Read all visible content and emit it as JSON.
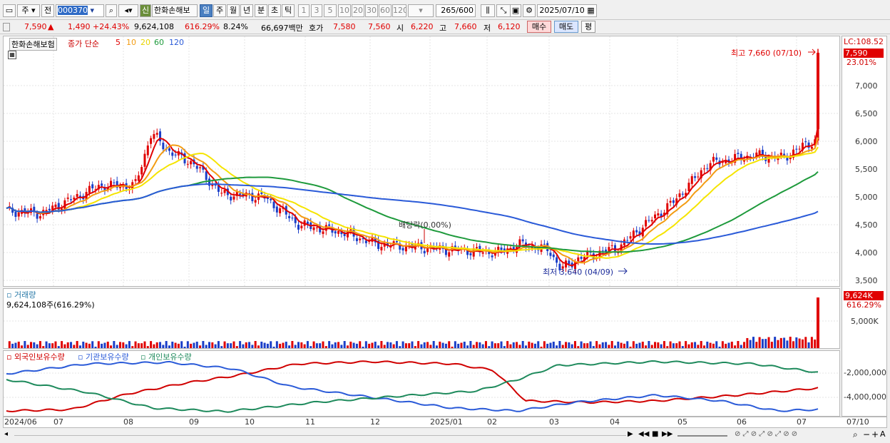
{
  "toolbar": {
    "market_left": "주",
    "prev_label": "전",
    "stock_code": "000370",
    "new_label": "신",
    "stock_name": "한화손해보",
    "periods": [
      "일",
      "주",
      "월",
      "년",
      "분",
      "초",
      "틱"
    ],
    "selected_period": "일",
    "minute_options": [
      "1",
      "3",
      "5",
      "10",
      "20",
      "30",
      "60",
      "120"
    ],
    "count": "265",
    "count_max": "/600",
    "date": "2025/07/10"
  },
  "info": {
    "price": "7,590",
    "change": "1,490",
    "change_pct": "+24.43%",
    "volume": "9,624,108",
    "volume_pct": "616.29%",
    "turnover": "8.24%",
    "amount": "66,697백만",
    "ask_label": "호가",
    "ask": "7,580",
    "bid": "7,560",
    "open_label": "시",
    "open": "6,220",
    "high_label": "고",
    "high": "7,660",
    "low_label": "저",
    "low": "6,120",
    "buy_label": "매수",
    "sell_label": "매도",
    "eval_label": "평"
  },
  "legend": {
    "name": "한화손해보험",
    "ma_title": "종가 단순",
    "ma": [
      "5",
      "10",
      "20",
      "60",
      "120"
    ]
  },
  "annotations": {
    "high": "최고 7,660 (07/10)",
    "low": "최저 3,640 (04/09)",
    "dividend": "배당락(0.00%)"
  },
  "right_axis": {
    "lc": "LC:108.52",
    "price_tag": "7,590",
    "pct_tag": "23.01%",
    "price_ticks": [
      "7,000",
      "6,500",
      "6,000",
      "5,500",
      "5,000",
      "4,500",
      "4,000",
      "3,500"
    ],
    "vol_tag": "9,624K",
    "vol_pct": "616.29%",
    "vol_tick": "5,000K",
    "holding_ticks": [
      "-2,000,000",
      "-4,000,000"
    ]
  },
  "volume_panel": {
    "title": "거래량",
    "value": "9,624,108주(616.29%)"
  },
  "holding_panel": {
    "series": [
      "외국인보유수량",
      "기관보유수량",
      "개인보유수량"
    ]
  },
  "x_axis": [
    "2024/06",
    "07",
    "08",
    "09",
    "10",
    "11",
    "12",
    "2025/01",
    "02",
    "03",
    "04",
    "05",
    "06",
    "07"
  ],
  "x_right": "07/10",
  "colors": {
    "up": "#e00000",
    "down": "#1a3ec8",
    "ma5": "#e00000",
    "ma10": "#f39c12",
    "ma20": "#f5e400",
    "ma60": "#1e9a3c",
    "ma120": "#2a5ad8"
  },
  "chart_data": {
    "type": "candlestick",
    "title": "한화손해보험",
    "ylim": [
      3500,
      7700
    ],
    "x_ticks": [
      "2024/06",
      "07",
      "08",
      "09",
      "10",
      "11",
      "12",
      "2025/01",
      "02",
      "03",
      "04",
      "05",
      "06",
      "07"
    ],
    "key_points": [
      {
        "date": "2024/06",
        "close": 4750
      },
      {
        "date": "2024/08",
        "close": 6100
      },
      {
        "date": "2024/09",
        "close": 5600
      },
      {
        "date": "2024/10",
        "close": 5000
      },
      {
        "date": "2024/11",
        "close": 4700
      },
      {
        "date": "2024/12",
        "close": 4300
      },
      {
        "date": "2025/01",
        "close": 4100
      },
      {
        "date": "2025/02",
        "close": 4000
      },
      {
        "date": "2025/03",
        "close": 4050
      },
      {
        "date": "2025/04/09",
        "close": 3640
      },
      {
        "date": "2025/05",
        "close": 4000
      },
      {
        "date": "2025/06",
        "close": 5700
      },
      {
        "date": "2025/07/10",
        "close": 7590
      }
    ],
    "high": 7660,
    "low": 3640,
    "last": 7590
  }
}
